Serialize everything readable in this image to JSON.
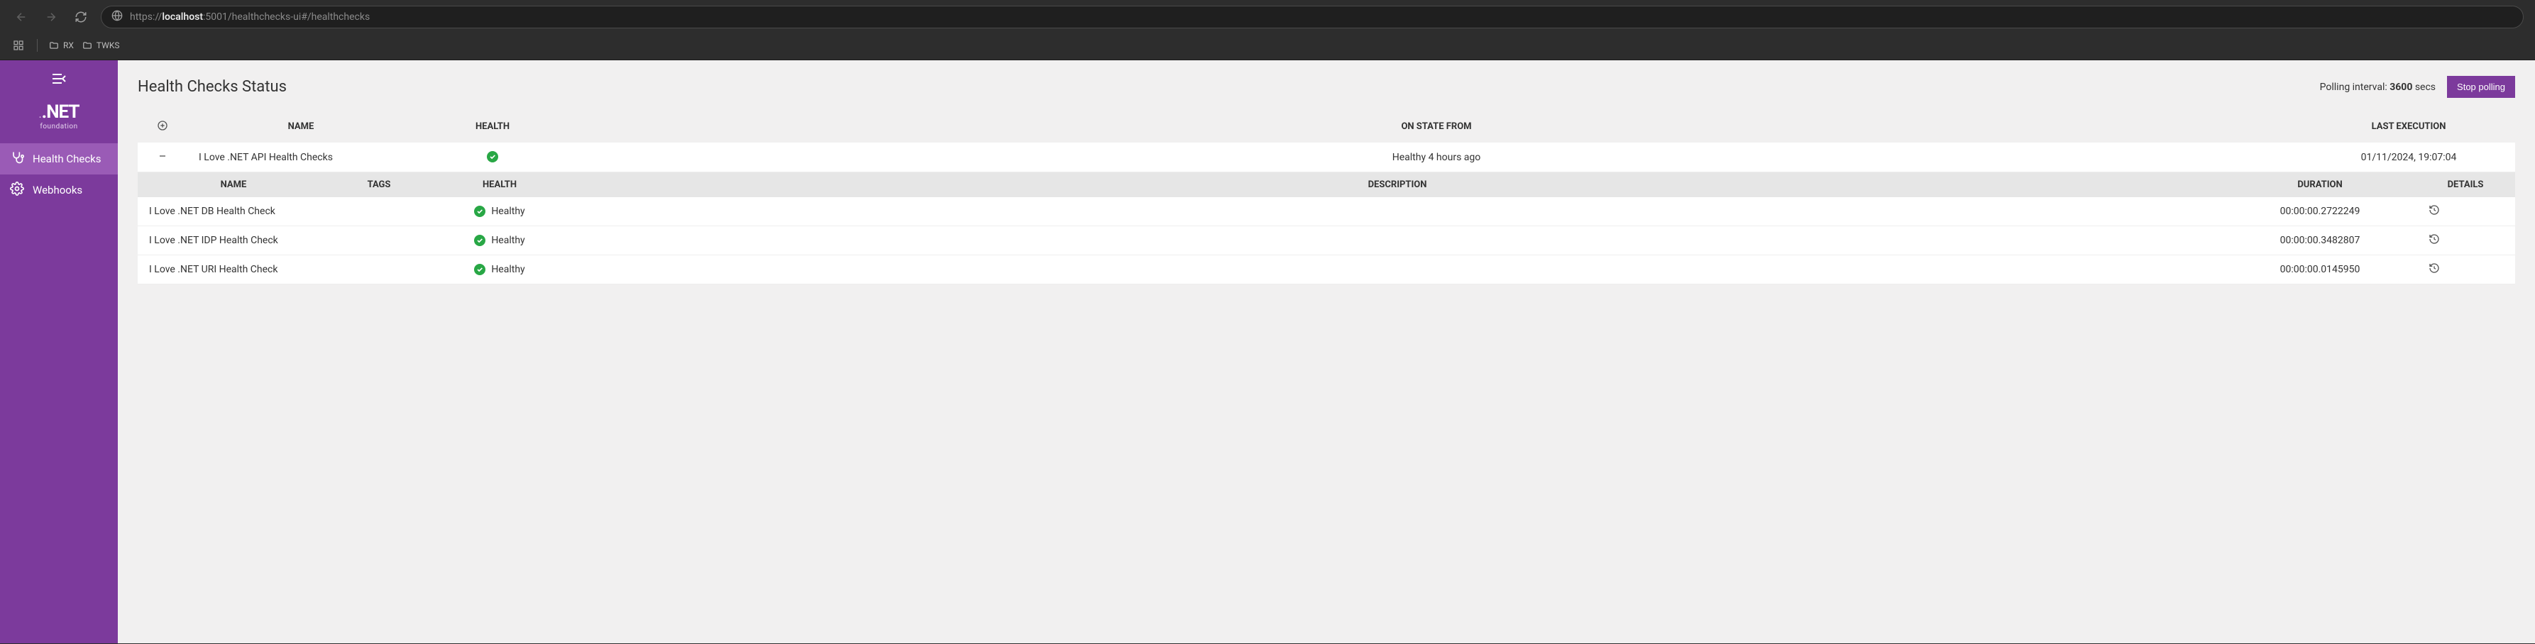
{
  "browser": {
    "url_scheme": "https://",
    "url_host": "localhost",
    "url_port_path": ":5001/healthchecks-ui#/healthchecks",
    "bookmarks": [
      {
        "label": "RX"
      },
      {
        "label": "TWKS"
      }
    ]
  },
  "sidebar": {
    "brand_name": ".NET",
    "brand_sub": "foundation",
    "items": [
      {
        "label": "Health Checks",
        "active": true,
        "icon": "stethoscope-icon"
      },
      {
        "label": "Webhooks",
        "active": false,
        "icon": "gear-icon"
      }
    ]
  },
  "header": {
    "title": "Health Checks Status",
    "polling_prefix": "Polling interval: ",
    "polling_value": "3600",
    "polling_suffix": " secs",
    "stop_label": "Stop polling"
  },
  "outer_table": {
    "columns": [
      "NAME",
      "HEALTH",
      "ON STATE FROM",
      "LAST EXECUTION"
    ],
    "row": {
      "name": "I Love .NET API Health Checks",
      "health": "healthy",
      "on_state_from": "Healthy 4 hours ago",
      "last_execution": "01/11/2024, 19:07:04"
    }
  },
  "inner_table": {
    "columns": [
      "NAME",
      "TAGS",
      "HEALTH",
      "DESCRIPTION",
      "DURATION",
      "DETAILS"
    ],
    "rows": [
      {
        "name": "I Love .NET DB Health Check",
        "tags": "",
        "health": "Healthy",
        "description": "",
        "duration": "00:00:00.2722249"
      },
      {
        "name": "I Love .NET IDP Health Check",
        "tags": "",
        "health": "Healthy",
        "description": "",
        "duration": "00:00:00.3482807"
      },
      {
        "name": "I Love .NET URI Health Check",
        "tags": "",
        "health": "Healthy",
        "description": "",
        "duration": "00:00:00.0145950"
      }
    ]
  }
}
